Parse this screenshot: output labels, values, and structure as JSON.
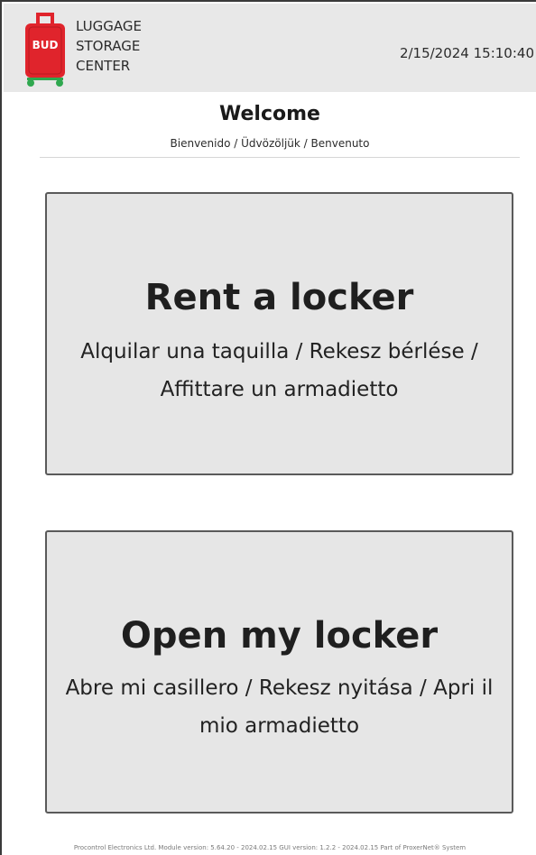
{
  "header": {
    "logo_text": "BUD",
    "brand_lines": [
      "LUGGAGE",
      "STORAGE",
      "CENTER"
    ],
    "datetime": "2/15/2024 15:10:40"
  },
  "welcome": {
    "title": "Welcome",
    "subtitle": "Bienvenido / Üdvözöljük / Benvenuto"
  },
  "actions": {
    "rent": {
      "title": "Rent a locker",
      "subtitle": "Alquilar una taquilla / Rekesz bérlése / Affittare un armadietto"
    },
    "open": {
      "title": "Open my locker",
      "subtitle": "Abre mi casillero / Rekesz nyitása / Apri il mio armadietto"
    }
  },
  "footer": {
    "text": "Procontrol Electronics Ltd.  Module version: 5.64.20 - 2024.02.15 GUI version: 1.2.2 - 2024.02.15  Part of ProxerNet® System"
  },
  "colors": {
    "header_bg": "#e8e8e8",
    "button_bg": "#e6e6e6",
    "button_border": "#5a5a5a",
    "suitcase_red": "#e0242c",
    "wheel_green": "#2fa84f"
  },
  "icons": {
    "logo": "red-suitcase-icon"
  }
}
